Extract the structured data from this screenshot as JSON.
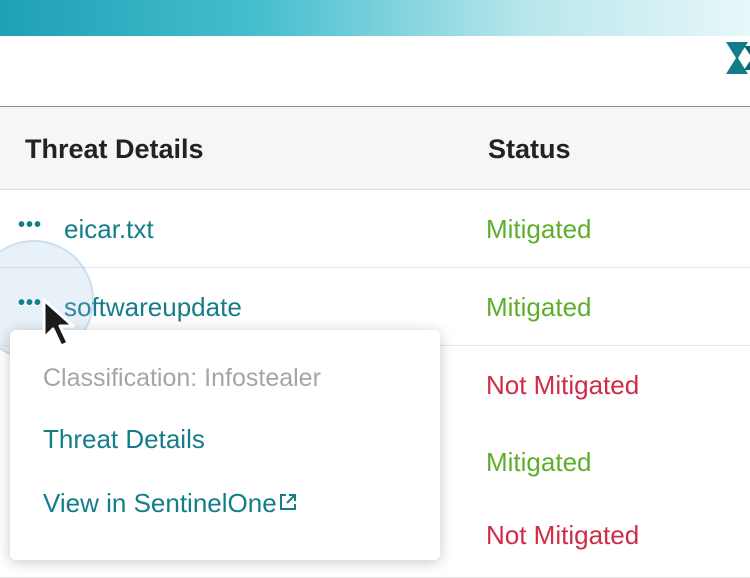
{
  "table": {
    "headers": {
      "threat_details": "Threat Details",
      "status": "Status"
    },
    "rows": [
      {
        "name": "eicar.txt",
        "status": "Mitigated",
        "status_color": "#5fae2b"
      },
      {
        "name": "softwareupdate",
        "status": "Mitigated",
        "status_color": "#5fae2b"
      },
      {
        "name": "",
        "status": "Not Mitigated",
        "status_color": "#d12c45"
      },
      {
        "name": "",
        "status": "Mitigated",
        "status_color": "#5fae2b"
      },
      {
        "name": "",
        "status": "Not Mitigated",
        "status_color": "#d12c45"
      }
    ],
    "row_menu_glyph": "•••"
  },
  "context_menu": {
    "classification": "Classification: Infostealer",
    "items": [
      "Threat Details",
      "View in SentinelOne"
    ],
    "external_icon": "external-link-icon"
  },
  "colors": {
    "accent": "#147d8a",
    "mitigated": "#5fae2b",
    "not_mitigated": "#d12c45",
    "brand_bar": "#1ea0b5"
  },
  "icons": [
    "logo-icon",
    "more-dots-icon",
    "cursor-arrow-icon",
    "external-link-icon"
  ]
}
